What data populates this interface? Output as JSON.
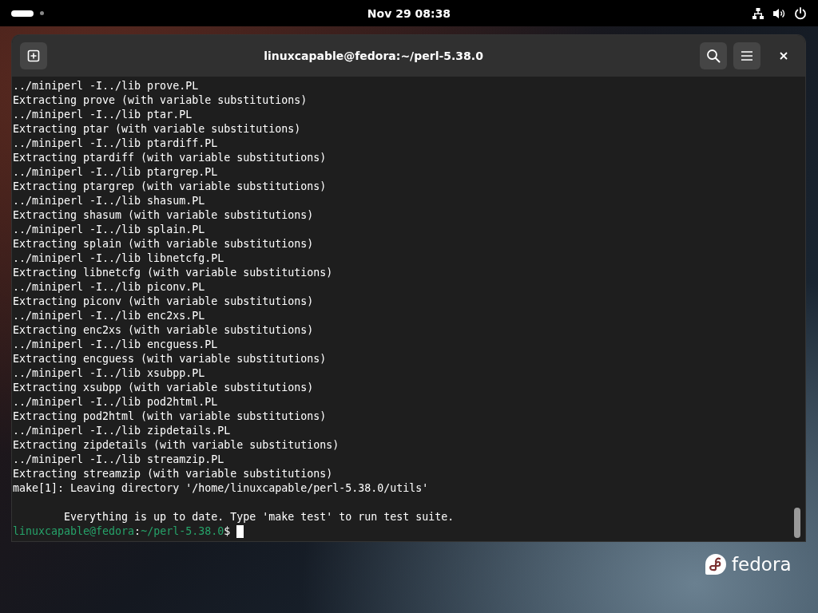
{
  "top_bar": {
    "clock": "Nov 29  08:38"
  },
  "window": {
    "title": "linuxcapable@fedora:~/perl-5.38.0"
  },
  "terminal": {
    "lines": [
      {
        "kind": "text",
        "text": "../miniperl -I../lib prove.PL"
      },
      {
        "kind": "text",
        "text": "Extracting prove (with variable substitutions)"
      },
      {
        "kind": "text",
        "text": "../miniperl -I../lib ptar.PL"
      },
      {
        "kind": "text",
        "text": "Extracting ptar (with variable substitutions)"
      },
      {
        "kind": "text",
        "text": "../miniperl -I../lib ptardiff.PL"
      },
      {
        "kind": "text",
        "text": "Extracting ptardiff (with variable substitutions)"
      },
      {
        "kind": "text",
        "text": "../miniperl -I../lib ptargrep.PL"
      },
      {
        "kind": "text",
        "text": "Extracting ptargrep (with variable substitutions)"
      },
      {
        "kind": "text",
        "text": "../miniperl -I../lib shasum.PL"
      },
      {
        "kind": "text",
        "text": "Extracting shasum (with variable substitutions)"
      },
      {
        "kind": "text",
        "text": "../miniperl -I../lib splain.PL"
      },
      {
        "kind": "text",
        "text": "Extracting splain (with variable substitutions)"
      },
      {
        "kind": "text",
        "text": "../miniperl -I../lib libnetcfg.PL"
      },
      {
        "kind": "text",
        "text": "Extracting libnetcfg (with variable substitutions)"
      },
      {
        "kind": "text",
        "text": "../miniperl -I../lib piconv.PL"
      },
      {
        "kind": "text",
        "text": "Extracting piconv (with variable substitutions)"
      },
      {
        "kind": "text",
        "text": "../miniperl -I../lib enc2xs.PL"
      },
      {
        "kind": "text",
        "text": "Extracting enc2xs (with variable substitutions)"
      },
      {
        "kind": "text",
        "text": "../miniperl -I../lib encguess.PL"
      },
      {
        "kind": "text",
        "text": "Extracting encguess (with variable substitutions)"
      },
      {
        "kind": "text",
        "text": "../miniperl -I../lib xsubpp.PL"
      },
      {
        "kind": "text",
        "text": "Extracting xsubpp (with variable substitutions)"
      },
      {
        "kind": "text",
        "text": "../miniperl -I../lib pod2html.PL"
      },
      {
        "kind": "text",
        "text": "Extracting pod2html (with variable substitutions)"
      },
      {
        "kind": "text",
        "text": "../miniperl -I../lib zipdetails.PL"
      },
      {
        "kind": "text",
        "text": "Extracting zipdetails (with variable substitutions)"
      },
      {
        "kind": "text",
        "text": "../miniperl -I../lib streamzip.PL"
      },
      {
        "kind": "text",
        "text": "Extracting streamzip (with variable substitutions)"
      },
      {
        "kind": "text",
        "text": "make[1]: Leaving directory '/home/linuxcapable/perl-5.38.0/utils'"
      },
      {
        "kind": "blank"
      },
      {
        "kind": "text",
        "text": "        Everything is up to date. Type 'make test' to run test suite."
      },
      {
        "kind": "prompt",
        "user_host": "linuxcapable@fedora",
        "separator": ":",
        "path": "~/perl-5.38.0",
        "symbol": "$"
      }
    ]
  },
  "desktop": {
    "logo_text": "fedora"
  }
}
